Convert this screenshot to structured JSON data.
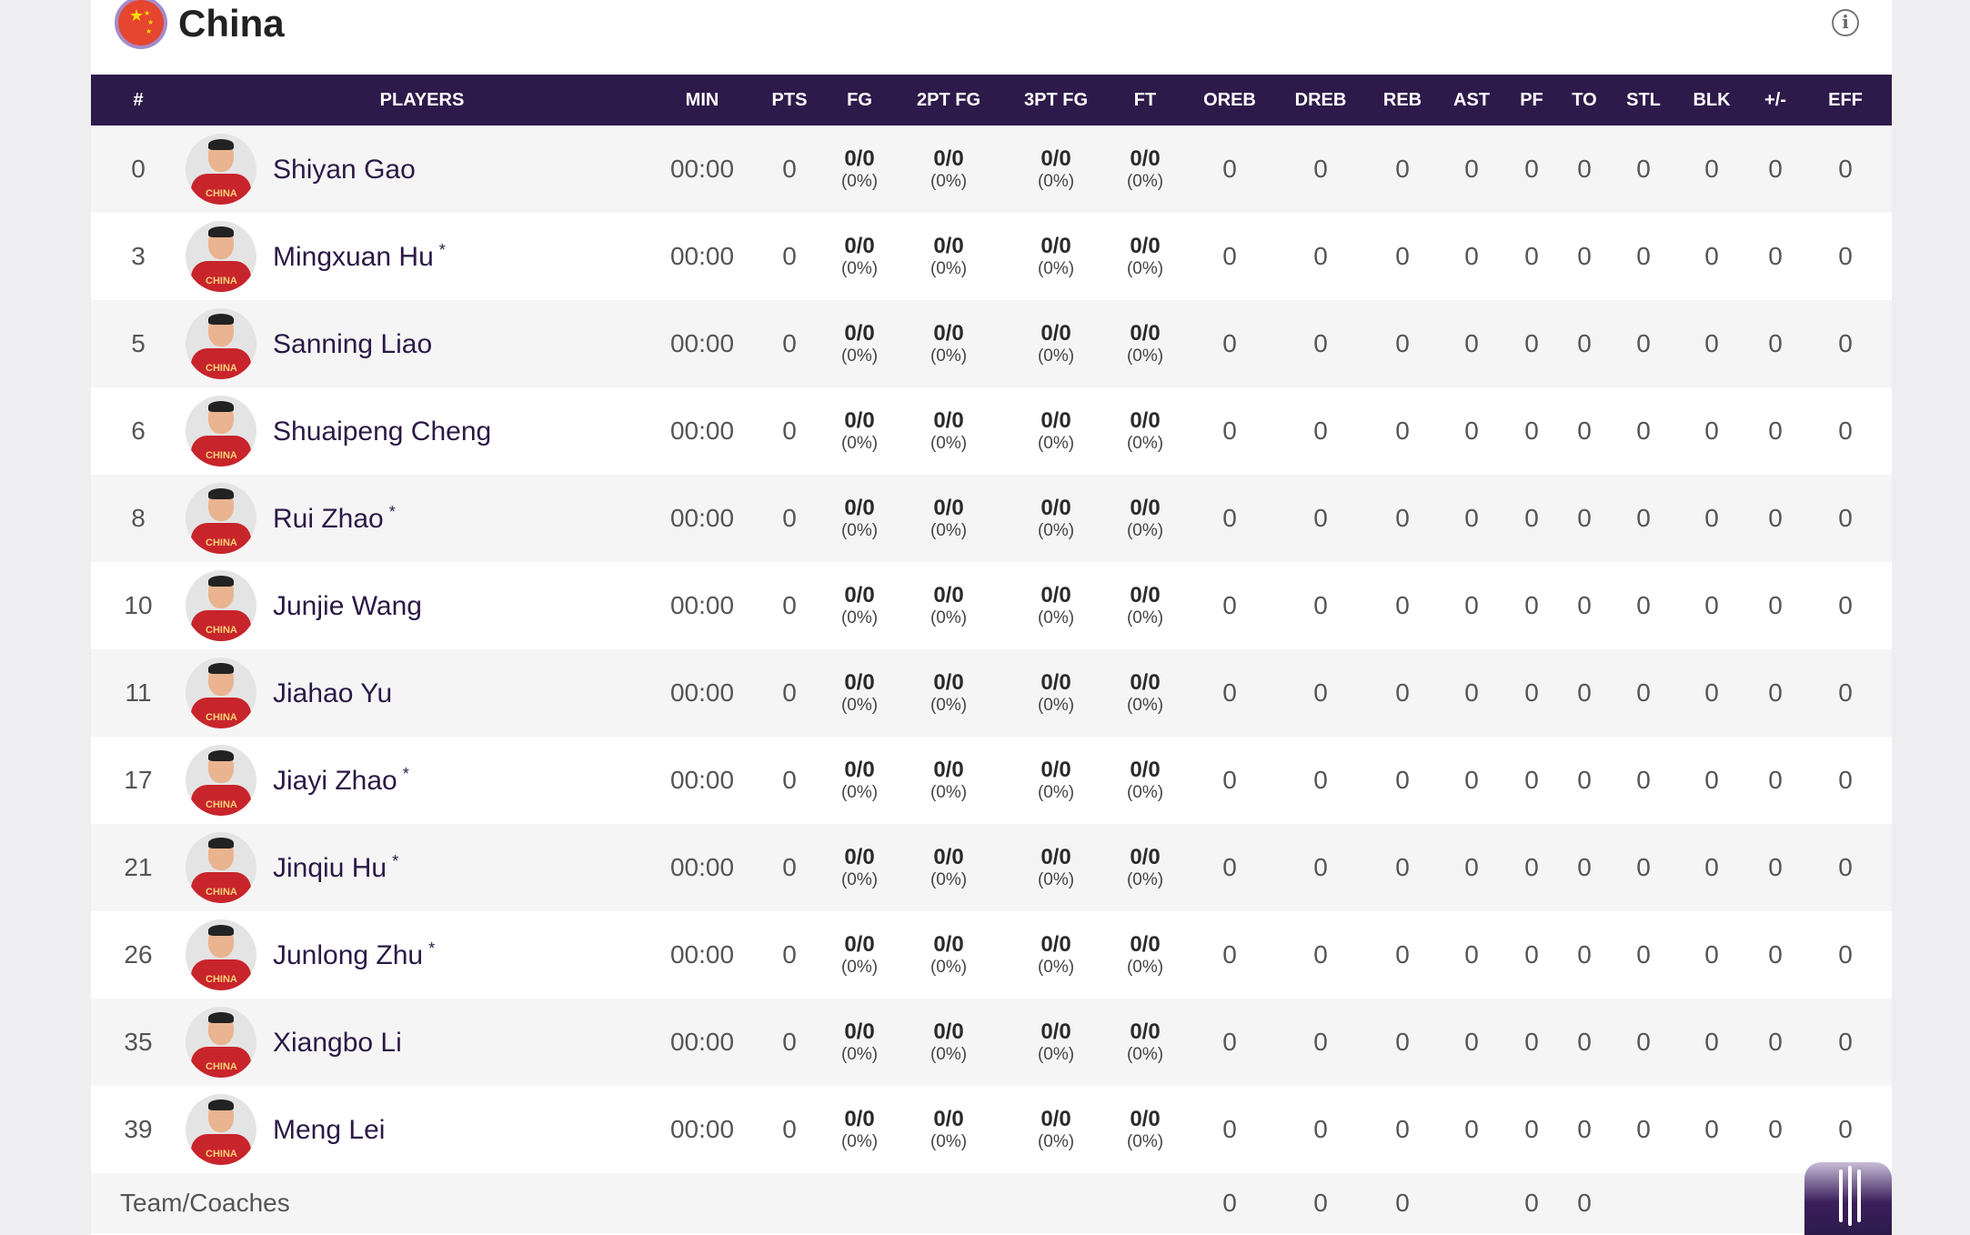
{
  "team": {
    "name": "China",
    "flag_icon": "china-flag-icon",
    "info_icon": "info-icon"
  },
  "columns": [
    "#",
    "PLAYERS",
    "MIN",
    "PTS",
    "FG",
    "2PT FG",
    "3PT FG",
    "FT",
    "OREB",
    "DREB",
    "REB",
    "AST",
    "PF",
    "TO",
    "STL",
    "BLK",
    "+/-",
    "EFF"
  ],
  "players": [
    {
      "num": "0",
      "name": "Shiyan Gao",
      "starter": "",
      "min": "00:00",
      "pts": "0",
      "fg": "0/0",
      "fg_pct": "(0%)",
      "fg2": "0/0",
      "fg2_pct": "(0%)",
      "fg3": "0/0",
      "fg3_pct": "(0%)",
      "ft": "0/0",
      "ft_pct": "(0%)",
      "oreb": "0",
      "dreb": "0",
      "reb": "0",
      "ast": "0",
      "pf": "0",
      "to": "0",
      "stl": "0",
      "blk": "0",
      "pm": "0",
      "eff": "0"
    },
    {
      "num": "3",
      "name": "Mingxuan Hu",
      "starter": "*",
      "min": "00:00",
      "pts": "0",
      "fg": "0/0",
      "fg_pct": "(0%)",
      "fg2": "0/0",
      "fg2_pct": "(0%)",
      "fg3": "0/0",
      "fg3_pct": "(0%)",
      "ft": "0/0",
      "ft_pct": "(0%)",
      "oreb": "0",
      "dreb": "0",
      "reb": "0",
      "ast": "0",
      "pf": "0",
      "to": "0",
      "stl": "0",
      "blk": "0",
      "pm": "0",
      "eff": "0"
    },
    {
      "num": "5",
      "name": "Sanning Liao",
      "starter": "",
      "min": "00:00",
      "pts": "0",
      "fg": "0/0",
      "fg_pct": "(0%)",
      "fg2": "0/0",
      "fg2_pct": "(0%)",
      "fg3": "0/0",
      "fg3_pct": "(0%)",
      "ft": "0/0",
      "ft_pct": "(0%)",
      "oreb": "0",
      "dreb": "0",
      "reb": "0",
      "ast": "0",
      "pf": "0",
      "to": "0",
      "stl": "0",
      "blk": "0",
      "pm": "0",
      "eff": "0"
    },
    {
      "num": "6",
      "name": "Shuaipeng Cheng",
      "starter": "",
      "min": "00:00",
      "pts": "0",
      "fg": "0/0",
      "fg_pct": "(0%)",
      "fg2": "0/0",
      "fg2_pct": "(0%)",
      "fg3": "0/0",
      "fg3_pct": "(0%)",
      "ft": "0/0",
      "ft_pct": "(0%)",
      "oreb": "0",
      "dreb": "0",
      "reb": "0",
      "ast": "0",
      "pf": "0",
      "to": "0",
      "stl": "0",
      "blk": "0",
      "pm": "0",
      "eff": "0"
    },
    {
      "num": "8",
      "name": "Rui Zhao",
      "starter": "*",
      "min": "00:00",
      "pts": "0",
      "fg": "0/0",
      "fg_pct": "(0%)",
      "fg2": "0/0",
      "fg2_pct": "(0%)",
      "fg3": "0/0",
      "fg3_pct": "(0%)",
      "ft": "0/0",
      "ft_pct": "(0%)",
      "oreb": "0",
      "dreb": "0",
      "reb": "0",
      "ast": "0",
      "pf": "0",
      "to": "0",
      "stl": "0",
      "blk": "0",
      "pm": "0",
      "eff": "0"
    },
    {
      "num": "10",
      "name": "Junjie Wang",
      "starter": "",
      "min": "00:00",
      "pts": "0",
      "fg": "0/0",
      "fg_pct": "(0%)",
      "fg2": "0/0",
      "fg2_pct": "(0%)",
      "fg3": "0/0",
      "fg3_pct": "(0%)",
      "ft": "0/0",
      "ft_pct": "(0%)",
      "oreb": "0",
      "dreb": "0",
      "reb": "0",
      "ast": "0",
      "pf": "0",
      "to": "0",
      "stl": "0",
      "blk": "0",
      "pm": "0",
      "eff": "0"
    },
    {
      "num": "11",
      "name": "Jiahao Yu",
      "starter": "",
      "min": "00:00",
      "pts": "0",
      "fg": "0/0",
      "fg_pct": "(0%)",
      "fg2": "0/0",
      "fg2_pct": "(0%)",
      "fg3": "0/0",
      "fg3_pct": "(0%)",
      "ft": "0/0",
      "ft_pct": "(0%)",
      "oreb": "0",
      "dreb": "0",
      "reb": "0",
      "ast": "0",
      "pf": "0",
      "to": "0",
      "stl": "0",
      "blk": "0",
      "pm": "0",
      "eff": "0"
    },
    {
      "num": "17",
      "name": "Jiayi Zhao",
      "starter": "*",
      "min": "00:00",
      "pts": "0",
      "fg": "0/0",
      "fg_pct": "(0%)",
      "fg2": "0/0",
      "fg2_pct": "(0%)",
      "fg3": "0/0",
      "fg3_pct": "(0%)",
      "ft": "0/0",
      "ft_pct": "(0%)",
      "oreb": "0",
      "dreb": "0",
      "reb": "0",
      "ast": "0",
      "pf": "0",
      "to": "0",
      "stl": "0",
      "blk": "0",
      "pm": "0",
      "eff": "0"
    },
    {
      "num": "21",
      "name": "Jinqiu Hu",
      "starter": "*",
      "min": "00:00",
      "pts": "0",
      "fg": "0/0",
      "fg_pct": "(0%)",
      "fg2": "0/0",
      "fg2_pct": "(0%)",
      "fg3": "0/0",
      "fg3_pct": "(0%)",
      "ft": "0/0",
      "ft_pct": "(0%)",
      "oreb": "0",
      "dreb": "0",
      "reb": "0",
      "ast": "0",
      "pf": "0",
      "to": "0",
      "stl": "0",
      "blk": "0",
      "pm": "0",
      "eff": "0"
    },
    {
      "num": "26",
      "name": "Junlong Zhu",
      "starter": "*",
      "min": "00:00",
      "pts": "0",
      "fg": "0/0",
      "fg_pct": "(0%)",
      "fg2": "0/0",
      "fg2_pct": "(0%)",
      "fg3": "0/0",
      "fg3_pct": "(0%)",
      "ft": "0/0",
      "ft_pct": "(0%)",
      "oreb": "0",
      "dreb": "0",
      "reb": "0",
      "ast": "0",
      "pf": "0",
      "to": "0",
      "stl": "0",
      "blk": "0",
      "pm": "0",
      "eff": "0"
    },
    {
      "num": "35",
      "name": "Xiangbo Li",
      "starter": "",
      "min": "00:00",
      "pts": "0",
      "fg": "0/0",
      "fg_pct": "(0%)",
      "fg2": "0/0",
      "fg2_pct": "(0%)",
      "fg3": "0/0",
      "fg3_pct": "(0%)",
      "ft": "0/0",
      "ft_pct": "(0%)",
      "oreb": "0",
      "dreb": "0",
      "reb": "0",
      "ast": "0",
      "pf": "0",
      "to": "0",
      "stl": "0",
      "blk": "0",
      "pm": "0",
      "eff": "0"
    },
    {
      "num": "39",
      "name": "Meng Lei",
      "starter": "",
      "min": "00:00",
      "pts": "0",
      "fg": "0/0",
      "fg_pct": "(0%)",
      "fg2": "0/0",
      "fg2_pct": "(0%)",
      "fg3": "0/0",
      "fg3_pct": "(0%)",
      "ft": "0/0",
      "ft_pct": "(0%)",
      "oreb": "0",
      "dreb": "0",
      "reb": "0",
      "ast": "0",
      "pf": "0",
      "to": "0",
      "stl": "0",
      "blk": "0",
      "pm": "0",
      "eff": "0"
    }
  ],
  "team_row": {
    "label": "Team/Coaches",
    "oreb": "0",
    "dreb": "0",
    "reb": "0",
    "pf": "0",
    "to": "0"
  },
  "avatar_jersey_text": "CHINA",
  "colors": {
    "header_bg": "#2d1a4a",
    "accent_purple": "#a58bc7",
    "flag_red": "#e6452f",
    "flag_star": "#ffde00"
  },
  "scroll_icon": "scroll-handle-icon"
}
